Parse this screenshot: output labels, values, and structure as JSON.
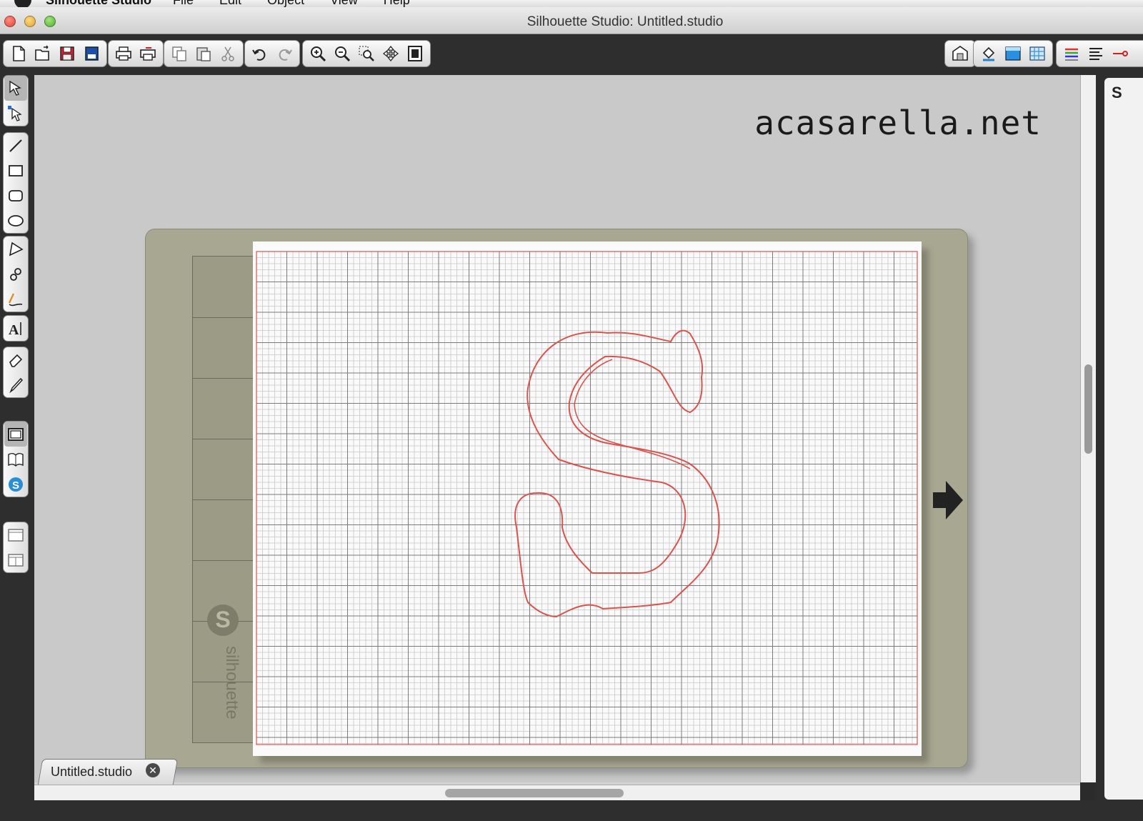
{
  "menubar": {
    "app_name": "Silhouette Studio",
    "items": [
      "File",
      "Edit",
      "Object",
      "View",
      "Help"
    ]
  },
  "window": {
    "title": "Silhouette Studio: Untitled.studio"
  },
  "toolbar": {
    "groups": [
      [
        "new-document-icon",
        "open-folder-icon",
        "save-icon",
        "save-to-library-icon"
      ],
      [
        "print-icon",
        "print-cut-icon"
      ],
      [
        "copy-icon",
        "paste-icon",
        "cut-icon"
      ],
      [
        "undo-icon",
        "redo-icon"
      ],
      [
        "zoom-in-icon",
        "zoom-out-icon",
        "zoom-select-icon",
        "pan-icon",
        "fit-to-page-icon"
      ]
    ],
    "right_groups": [
      [
        "store-icon"
      ],
      [
        "fill-color-icon",
        "line-color-icon",
        "fill-pattern-icon"
      ],
      [
        "line-style-icon",
        "align-icon",
        "cut-settings-icon"
      ]
    ]
  },
  "toolbox": [
    [
      "select-icon",
      "point-edit-icon"
    ],
    [
      "line-tool-icon",
      "rectangle-tool-icon",
      "rounded-rectangle-tool-icon",
      "ellipse-tool-icon"
    ],
    [
      "polygon-tool-icon",
      "curve-tool-icon",
      "freehand-tool-icon"
    ],
    [
      "text-tool-icon"
    ],
    [
      "eraser-tool-icon",
      "knife-tool-icon"
    ],
    [
      "page-setup-icon",
      "library-icon",
      "silhouette-store-icon"
    ],
    [
      "single-view-icon",
      "split-view-icon"
    ]
  ],
  "canvas": {
    "watermark": "acasarella.net",
    "mat_brand": "silhouette",
    "mat_logo_letter": "S",
    "design_letter": "S",
    "cut_line_color": "#d9534f",
    "mat_color": "#a8a892"
  },
  "document_tab": {
    "label": "Untitled.studio",
    "close_symbol": "✕"
  },
  "side_panel": {
    "header_initial": "S"
  }
}
